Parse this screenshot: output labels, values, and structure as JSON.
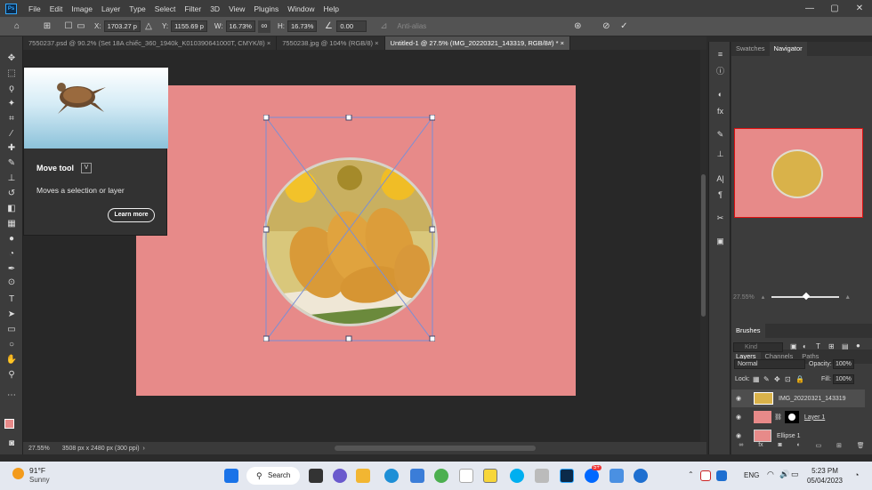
{
  "app": {
    "logo": "Ps"
  },
  "menubar": {
    "items": [
      "File",
      "Edit",
      "Image",
      "Layer",
      "Type",
      "Select",
      "Filter",
      "3D",
      "View",
      "Plugins",
      "Window",
      "Help"
    ]
  },
  "window_controls": {
    "minimize": "—",
    "maximize": "▢",
    "close": "✕"
  },
  "options": {
    "x_label": "X:",
    "x_value": "1703.27 p",
    "y_label": "Y:",
    "y_value": "1155.69 p",
    "w_label": "W:",
    "w_value": "16.73%",
    "h_label": "H:",
    "h_value": "16.73%",
    "angle_value": "0.00",
    "antialias_label": "Anti-alias"
  },
  "tabs": [
    {
      "label": "7550237.psd @ 90.2% (Set 18A chiếc_360_1940k_K010390641000T, CMYK/8)",
      "close": "×"
    },
    {
      "label": "7550238.jpg @ 104% (RGB/8)",
      "close": "×"
    },
    {
      "label": "Untitled-1 @ 27.5% (IMG_20220321_143319, RGB/8#) *",
      "close": "×"
    }
  ],
  "tooltip": {
    "title": "Move tool",
    "shortcut": "V",
    "description": "Moves a selection or layer",
    "button": "Learn more"
  },
  "status": {
    "zoom": "27.55%",
    "doc_info": "3508 px x 2480 px (300 ppi)"
  },
  "panels": {
    "top_tabs": [
      "Swatches",
      "Navigator"
    ],
    "nav_zoom": "27.55%",
    "brushes": "Brushes",
    "layer_tabs": [
      "Layers",
      "Channels",
      "Paths"
    ],
    "kind_placeholder": "Kind",
    "blend_mode": "Normal",
    "opacity_label": "Opacity:",
    "opacity_value": "100%",
    "lock_label": "Lock:",
    "fill_label": "Fill:",
    "fill_value": "100%"
  },
  "layers": [
    {
      "name": "IMG_20220321_143319",
      "selected": true
    },
    {
      "name": "Layer 1",
      "selected": false
    },
    {
      "name": "Ellipse 1",
      "selected": false
    }
  ],
  "taskbar": {
    "temp": "91°F",
    "weather": "Sunny",
    "search": "Search",
    "lang": "ENG",
    "time": "5:23 PM",
    "date": "05/04/2023",
    "badge": "5+"
  },
  "colors": {
    "canvas_pink": "#e78a89",
    "accent": "#31a8ff"
  }
}
